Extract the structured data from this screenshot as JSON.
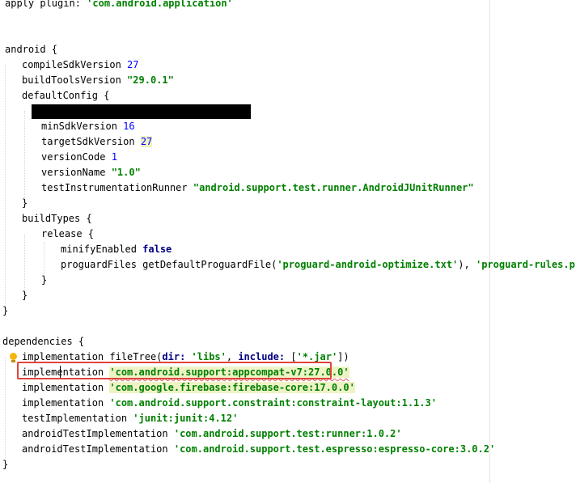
{
  "code": {
    "l1": {
      "a": "apply plugin: ",
      "b": "'com.android.application'"
    },
    "l2": {
      "a": "android {"
    },
    "l3": {
      "a": "compileSdkVersion ",
      "n": "27"
    },
    "l4": {
      "a": "buildToolsVersion ",
      "s": "\"29.0.1\""
    },
    "l5": {
      "a": "defaultConfig {"
    },
    "l6": {
      "a": "minSdkVersion ",
      "n": "16"
    },
    "l7": {
      "a": "targetSdkVersion ",
      "n": "27"
    },
    "l8": {
      "a": "versionCode ",
      "n": "1"
    },
    "l9": {
      "a": "versionName ",
      "s": "\"1.0\""
    },
    "l10": {
      "a": "testInstrumentationRunner ",
      "s": "\"android.support.test.runner.AndroidJUnitRunner\""
    },
    "l11": {
      "a": "}"
    },
    "l12": {
      "a": "buildTypes {"
    },
    "l13": {
      "a": "release {"
    },
    "l14": {
      "a": "minifyEnabled ",
      "k": "false"
    },
    "l15": {
      "a": "proguardFiles getDefaultProguardFile(",
      "s1": "'proguard-android-optimize.txt'",
      "b": "), ",
      "s2": "'proguard-rules.pro'"
    },
    "l16": {
      "a": "}"
    },
    "l17": {
      "a": "}"
    },
    "l18": {
      "a": "}"
    },
    "l19": {
      "a": "dependencies {"
    },
    "l20": {
      "a": "implementation fileTree(",
      "k1": "dir: ",
      "s1": "'libs'",
      "b": ", ",
      "k2": "include: ",
      "c": "[",
      "s2": "'*.jar'",
      "d": "])"
    },
    "l21": {
      "a": "implementation ",
      "s": "'com.android.support:appcompat-v7:27.0.0'"
    },
    "l22": {
      "a": "implementation ",
      "s": "'com.google.firebase:firebase-core:17.0.0'"
    },
    "l23": {
      "a": "implementation ",
      "s": "'com.android.support.constraint:constraint-layout:1.1.3'"
    },
    "l24": {
      "a": "testImplementation ",
      "s": "'junit:junit:4.12'"
    },
    "l25": {
      "a": "androidTestImplementation ",
      "s": "'com.android.support.test:runner:1.0.2'"
    },
    "l26": {
      "a": "androidTestImplementation ",
      "s": "'com.android.support.test.espresso:espresso-core:3.0.2'"
    },
    "l27": {
      "a": "}"
    }
  },
  "colors": {
    "string": "#008000",
    "number": "#0000ff",
    "keyword": "#000080",
    "highlight": "#eef3c6",
    "annotation_box": "#e0443b",
    "intention_bulb": "#f5b50a"
  },
  "icons": {
    "intention": "lightbulb-icon"
  }
}
